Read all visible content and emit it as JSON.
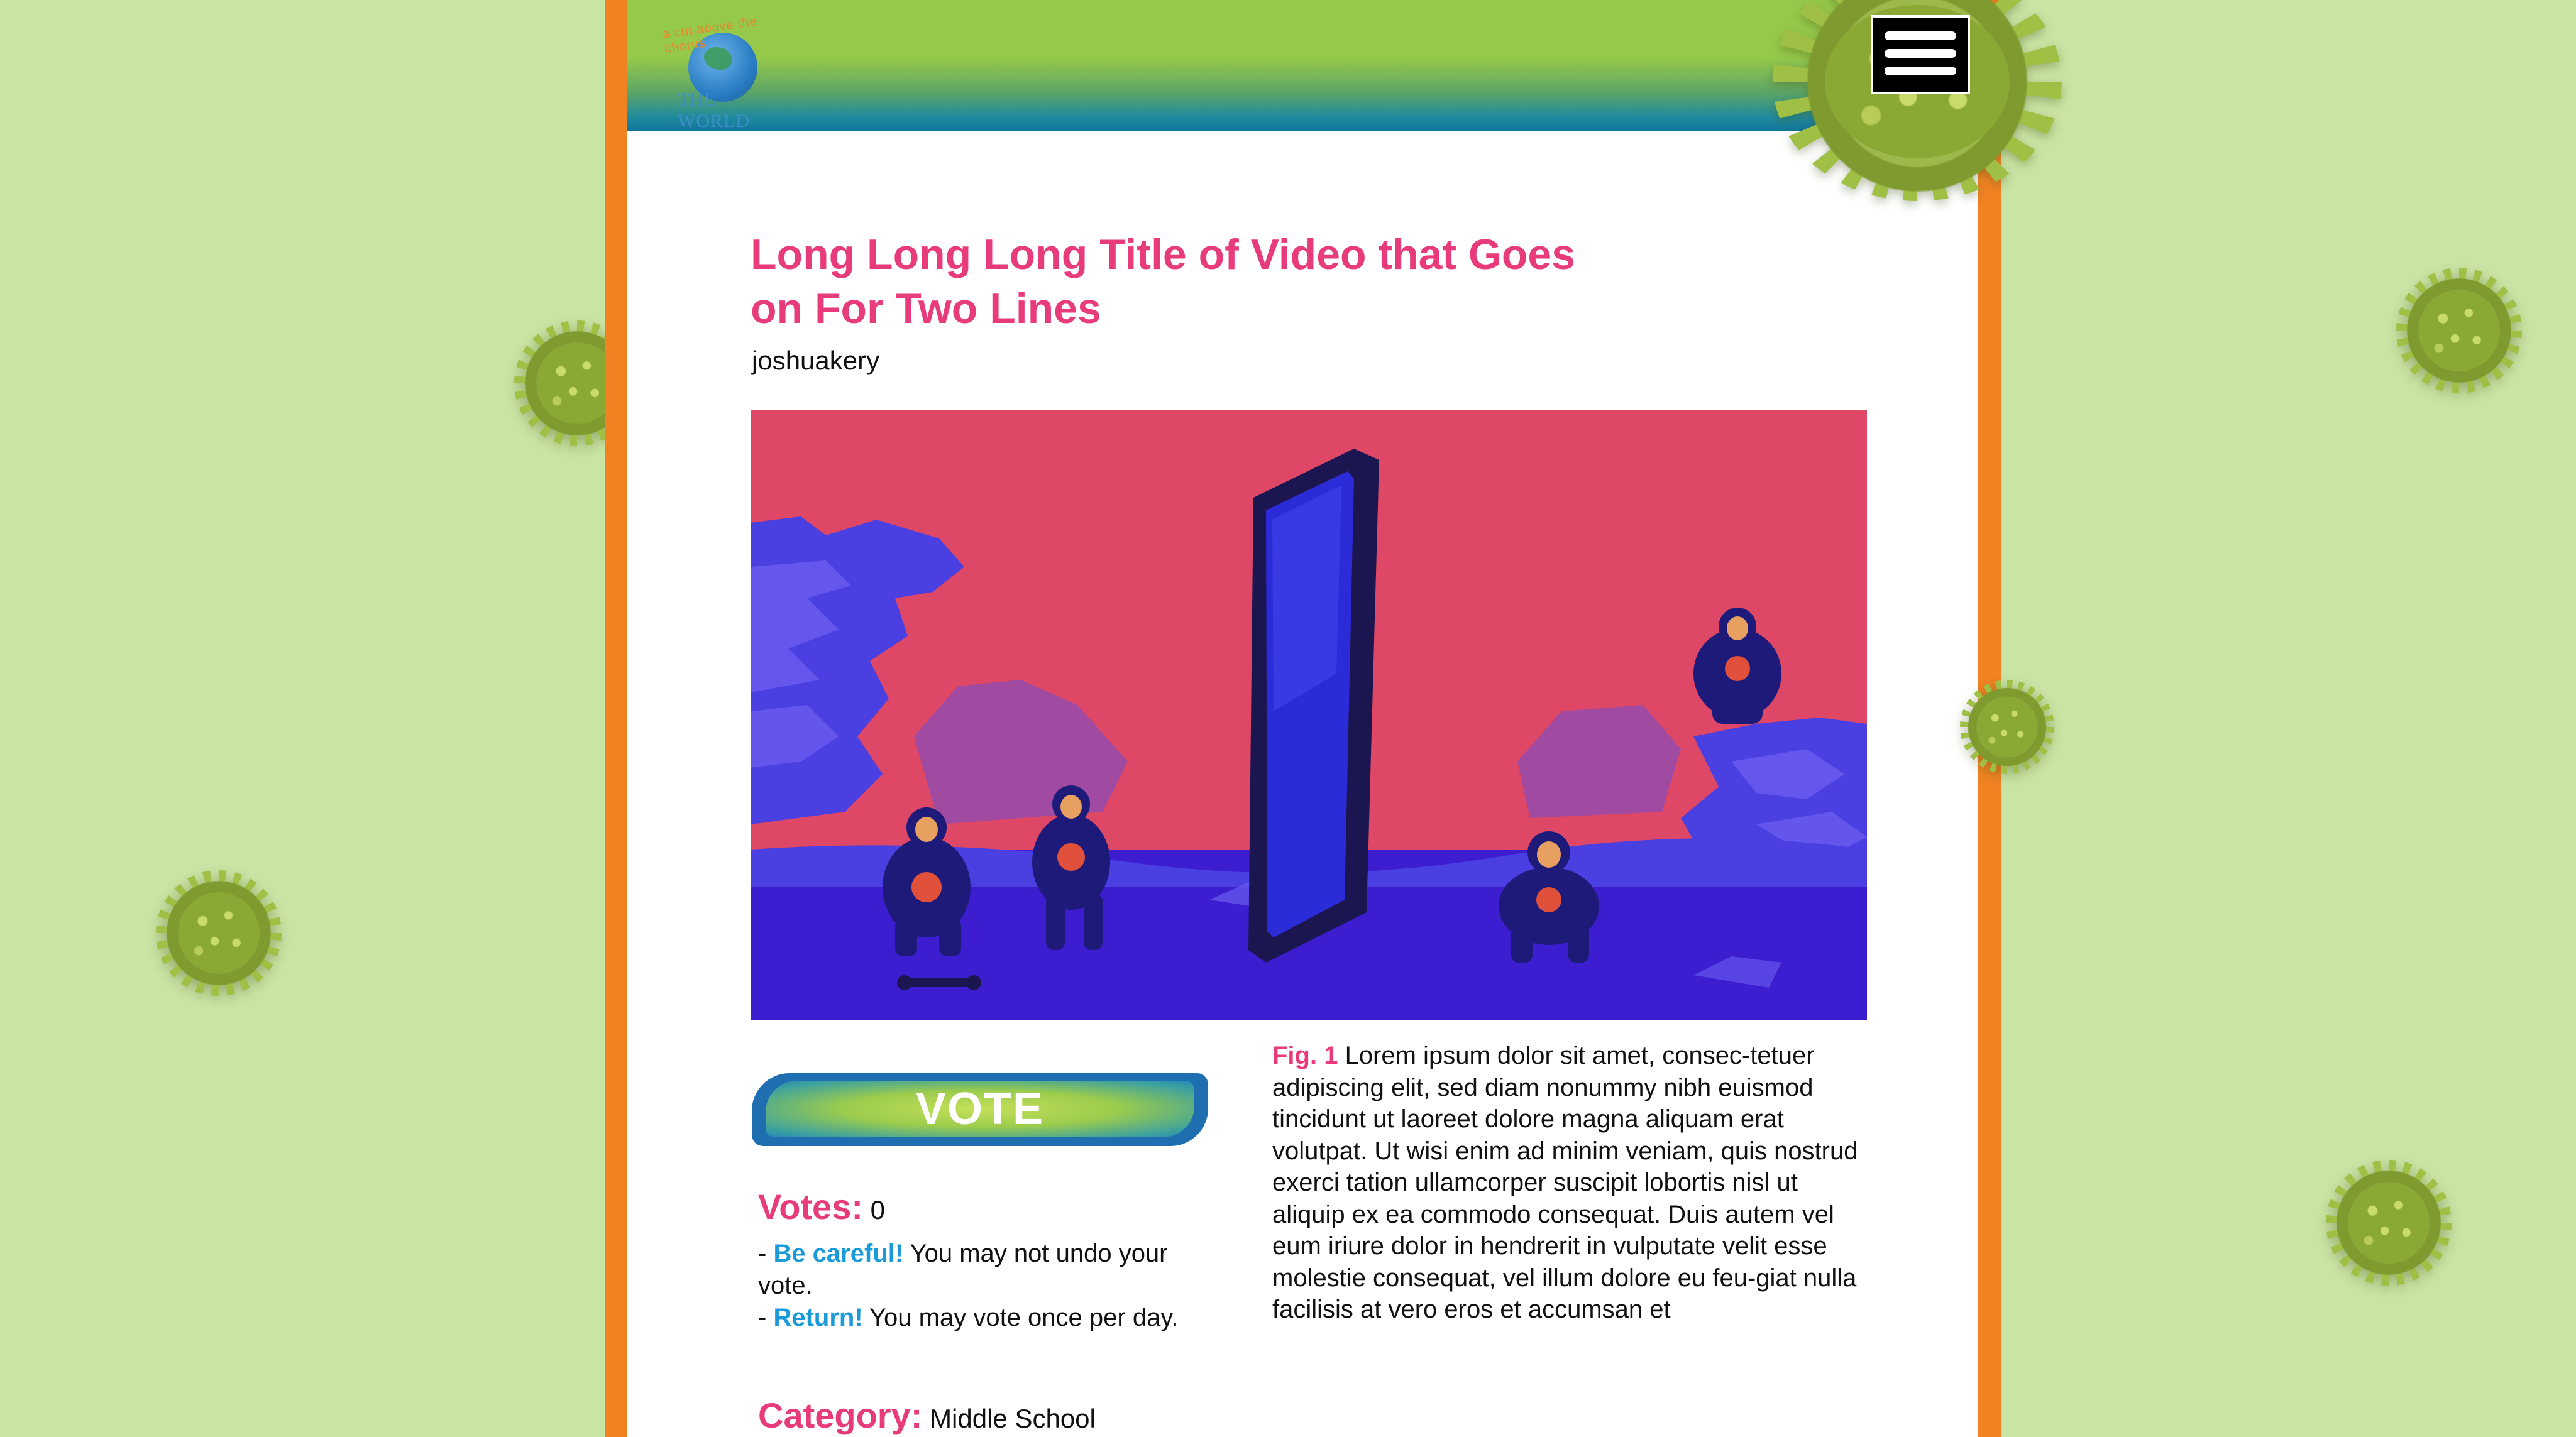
{
  "header": {
    "logo_arc_text": "a cut above the chorus",
    "logo_world_text": "THE WORLD",
    "menu_icon": "hamburger-menu-icon"
  },
  "video": {
    "title": "Long Long Long Title of Video that Goes on For Two Lines",
    "author": "joshuakery"
  },
  "vote": {
    "button_label": "VOTE",
    "votes_label": "Votes:",
    "votes_count": "0",
    "warning_prefix": "- ",
    "warning_label": "Be careful!",
    "warning_text": " You may not undo your vote.",
    "return_prefix": "- ",
    "return_label": "Return!",
    "return_text": " You may vote once per day."
  },
  "category": {
    "label": "Category:",
    "value": "Middle School"
  },
  "caption": {
    "fig_label": "Fig. 1",
    "text": " Lorem ipsum dolor sit amet, consec-tetuer adipiscing elit, sed diam nonummy nibh euismod tincidunt ut laoreet dolore magna aliquam erat volutpat. Ut wisi enim ad minim veniam, quis nostrud exerci tation ullamcorper suscipit lobortis nisl ut aliquip ex ea commodo consequat. Duis autem vel eum iriure dolor in hendrerit in vulputate velit esse molestie consequat, vel illum dolore eu feu-giat nulla facilisis at vero eros et accumsan et"
  },
  "colors": {
    "background": "#c9e4a4",
    "frame_orange": "#f08222",
    "header_green": "#96c94a",
    "header_blue": "#12769c",
    "title_pink": "#e73b7b",
    "highlight_blue": "#1a9ad8",
    "video_sky": "#de4765",
    "video_rock": "#4a3fe0"
  }
}
